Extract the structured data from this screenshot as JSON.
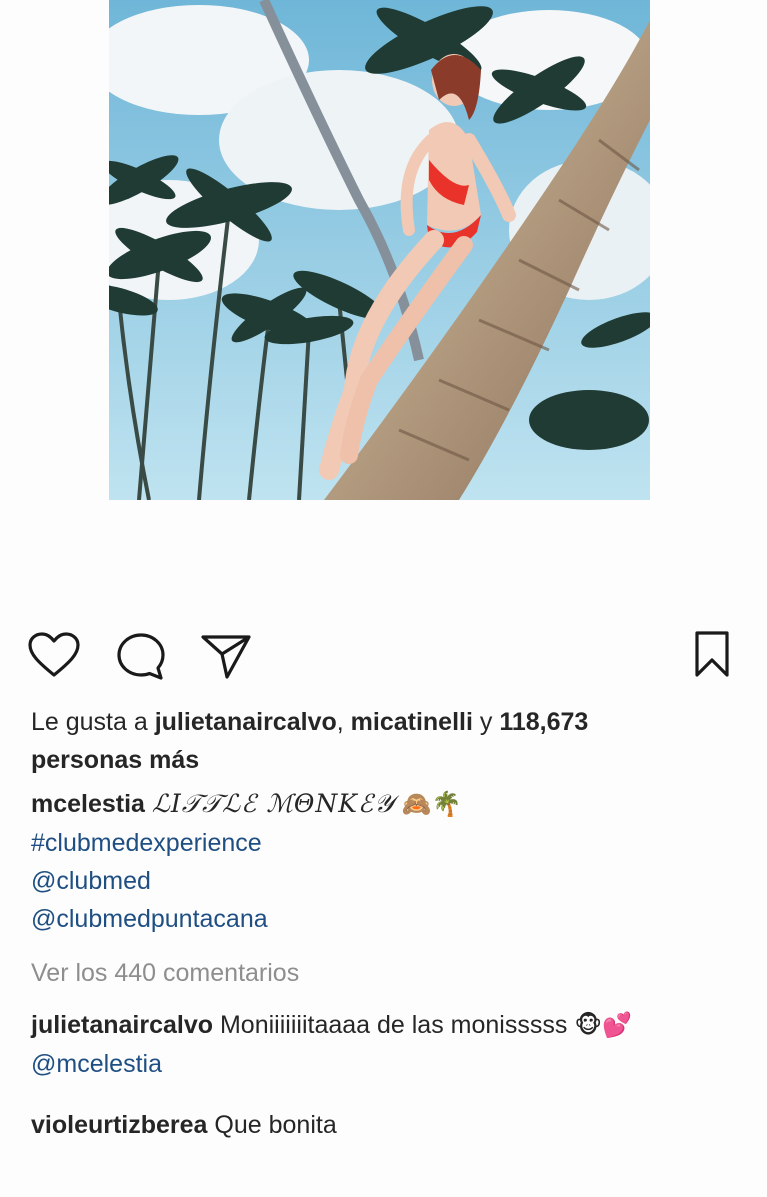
{
  "photo": {
    "alt_subject": "woman in red bikini climbing a palm tree",
    "colors": {
      "sky": "#8ec9e4",
      "cloud": "#f2f5f7",
      "palm_dark": "#1d3a30",
      "trunk": "#a08568",
      "bikini": "#e8322a",
      "skin": "#f1c9b4"
    }
  },
  "actions": {
    "like_icon": "heart-icon",
    "comment_icon": "speech-bubble-icon",
    "share_icon": "paper-plane-icon",
    "save_icon": "bookmark-icon"
  },
  "likes": {
    "prefix": "Le gusta a ",
    "user1": "julietanaircalvo",
    "sep": ", ",
    "user2": "micatinelli",
    "conj": " y ",
    "count": "118,673",
    "suffix": "personas más"
  },
  "caption": {
    "username": "mcelestia",
    "text": "ℒ𝐼𝒯𝒯ℒℰ ℳ𝛩𝛮𝛫ℰ𝒴",
    "emoji": "🙈🌴",
    "hashtag": "#clubmedexperience",
    "mention1": "@clubmed",
    "mention2": "@clubmedpuntacana"
  },
  "view_comments": "Ver los 440 comentarios",
  "comments": [
    {
      "username": "julietanaircalvo",
      "text": "Moniiiiiiitaaaa de las monisssss",
      "emoji": "🐵💕",
      "mention": "@mcelestia"
    },
    {
      "username": "violeurtizberea",
      "text": "Que bonita"
    }
  ]
}
